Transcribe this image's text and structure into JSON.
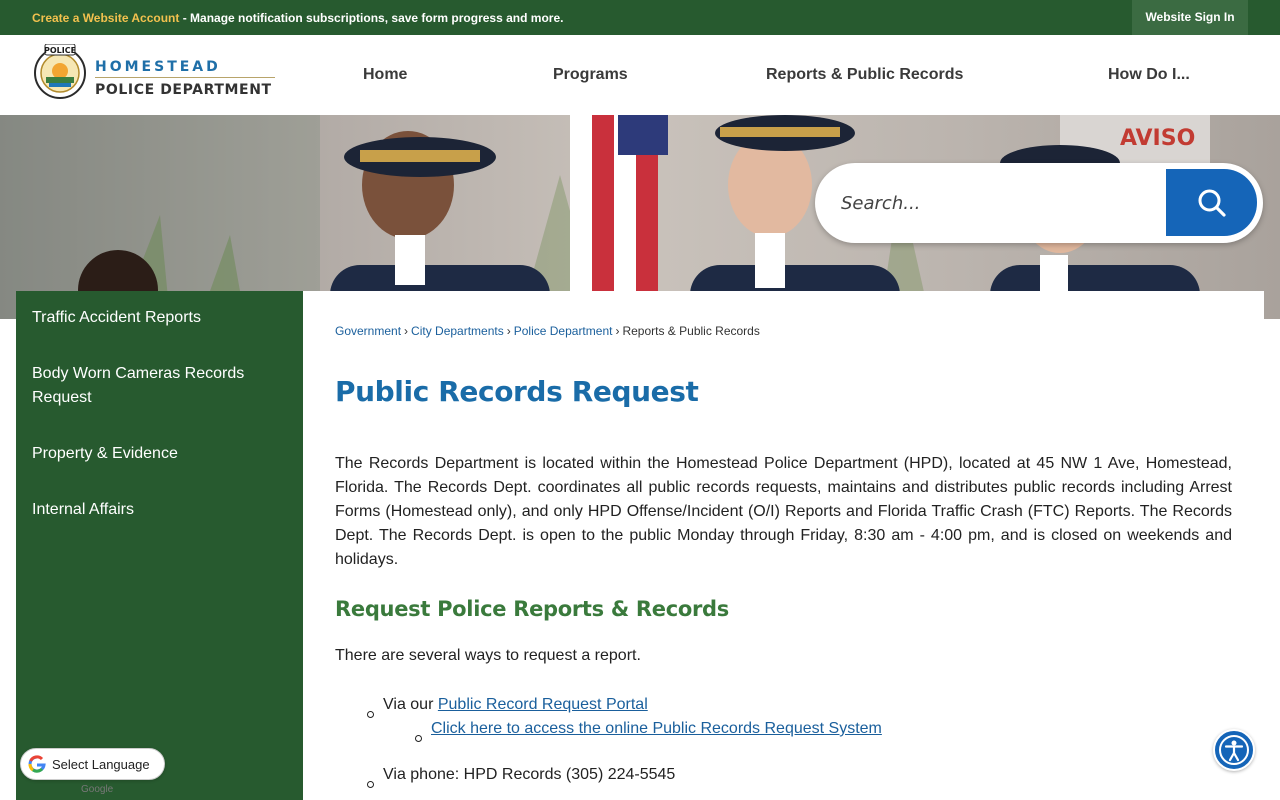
{
  "topbar": {
    "account_link": "Create a Website Account",
    "message": " - Manage notification subscriptions, save form progress and more.",
    "signin": "Website Sign In"
  },
  "header": {
    "logo": {
      "line1": "HOMESTEAD",
      "line2": "POLICE DEPARTMENT",
      "seal_text": "POLICE"
    },
    "nav": [
      "Home",
      "Programs",
      "Reports & Public Records",
      "How Do I..."
    ]
  },
  "search": {
    "placeholder": "Search..."
  },
  "sidebar": {
    "items": [
      "Traffic Accident Reports",
      "Body Worn Cameras Records Request",
      "Property & Evidence",
      "Internal Affairs"
    ]
  },
  "breadcrumb": {
    "links": [
      "Government",
      "City Departments",
      "Police Department"
    ],
    "separator": "›",
    "current": "Reports & Public Records"
  },
  "main": {
    "title": "Public Records Request",
    "paragraph": "The Records Department is located within the Homestead Police Department (HPD), located at 45 NW 1 Ave, Homestead, Florida. The Records Dept. coordinates all public records requests, maintains and distributes public records including Arrest Forms (Homestead only), and only HPD Offense/Incident (O/I) Reports and Florida Traffic Crash (FTC) Reports. The Records Dept. The Records Dept. is open to the public Monday through Friday, 8:30 am - 4:00 pm, and is closed on weekends and holidays.",
    "subheading": "Request Police Reports & Records",
    "intro": "There are several ways to request a report.",
    "list": {
      "portal_prefix": "Via our ",
      "portal_link": "Public Record Request Portal",
      "portal_sublink": "Click here to access the online Public Records Request System",
      "phone": "Via phone: HPD Records (305) 224-5545"
    }
  },
  "widgets": {
    "translate_label": "Select Language",
    "powered_by": "Google"
  },
  "colors": {
    "brand_green": "#275a2f",
    "link_blue": "#1a5f9c",
    "title_blue": "#1a6ca8",
    "subhead_green": "#3a7a3c",
    "search_blue": "#1565b8",
    "account_yellow": "#f2c14e"
  }
}
